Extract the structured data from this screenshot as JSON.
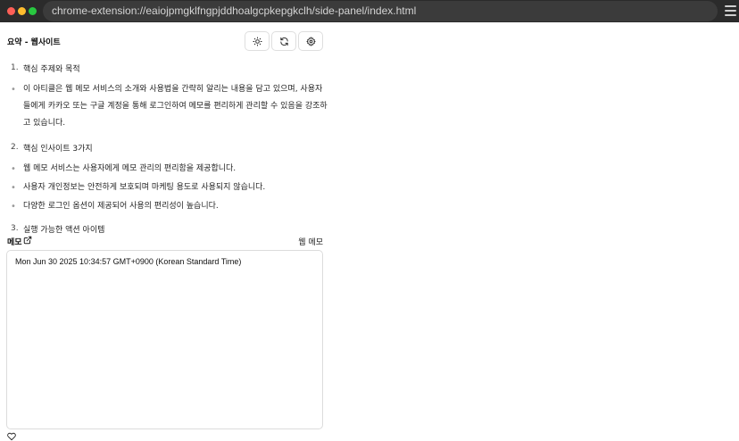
{
  "browser": {
    "url": "chrome-extension://eaiojpmgklfngpjddhoalgcpkepgkclh/side-panel/index.html"
  },
  "header": {
    "title": "요약 - 웹사이트"
  },
  "summary": {
    "sections": [
      {
        "number": "1.",
        "title": "핵심 주제와 목적",
        "bullets": [
          "이 아티클은 웹 메모 서비스의 소개와 사용법을 간략히 알리는 내용을 담고 있으며, 사용자들에게 카카오 또는 구글 계정을 통해 로그인하여 메모를 편리하게 관리할 수 있음을 강조하고 있습니다."
        ]
      },
      {
        "number": "2.",
        "title": "핵심 인사이트 3가지",
        "bullets": [
          "웹 메모 서비스는 사용자에게 메모 관리의 편리함을 제공합니다.",
          "사용자 개인정보는 안전하게 보호되며 마케팅 용도로 사용되지 않습니다.",
          "다양한 로그인 옵션이 제공되어 사용의 편리성이 높습니다."
        ]
      },
      {
        "number": "3.",
        "title": "실행 가능한 액션 아이템",
        "bullets": []
      }
    ]
  },
  "memo": {
    "label": "메모",
    "source": "웹 메모",
    "content": "Mon Jun 30 2025 10:34:57 GMT+0900 (Korean Standard Time)"
  },
  "icons": {
    "theme": "sun-icon",
    "refresh": "refresh-icon",
    "settings": "gear-icon",
    "external": "external-link-icon",
    "heart": "heart-icon"
  }
}
